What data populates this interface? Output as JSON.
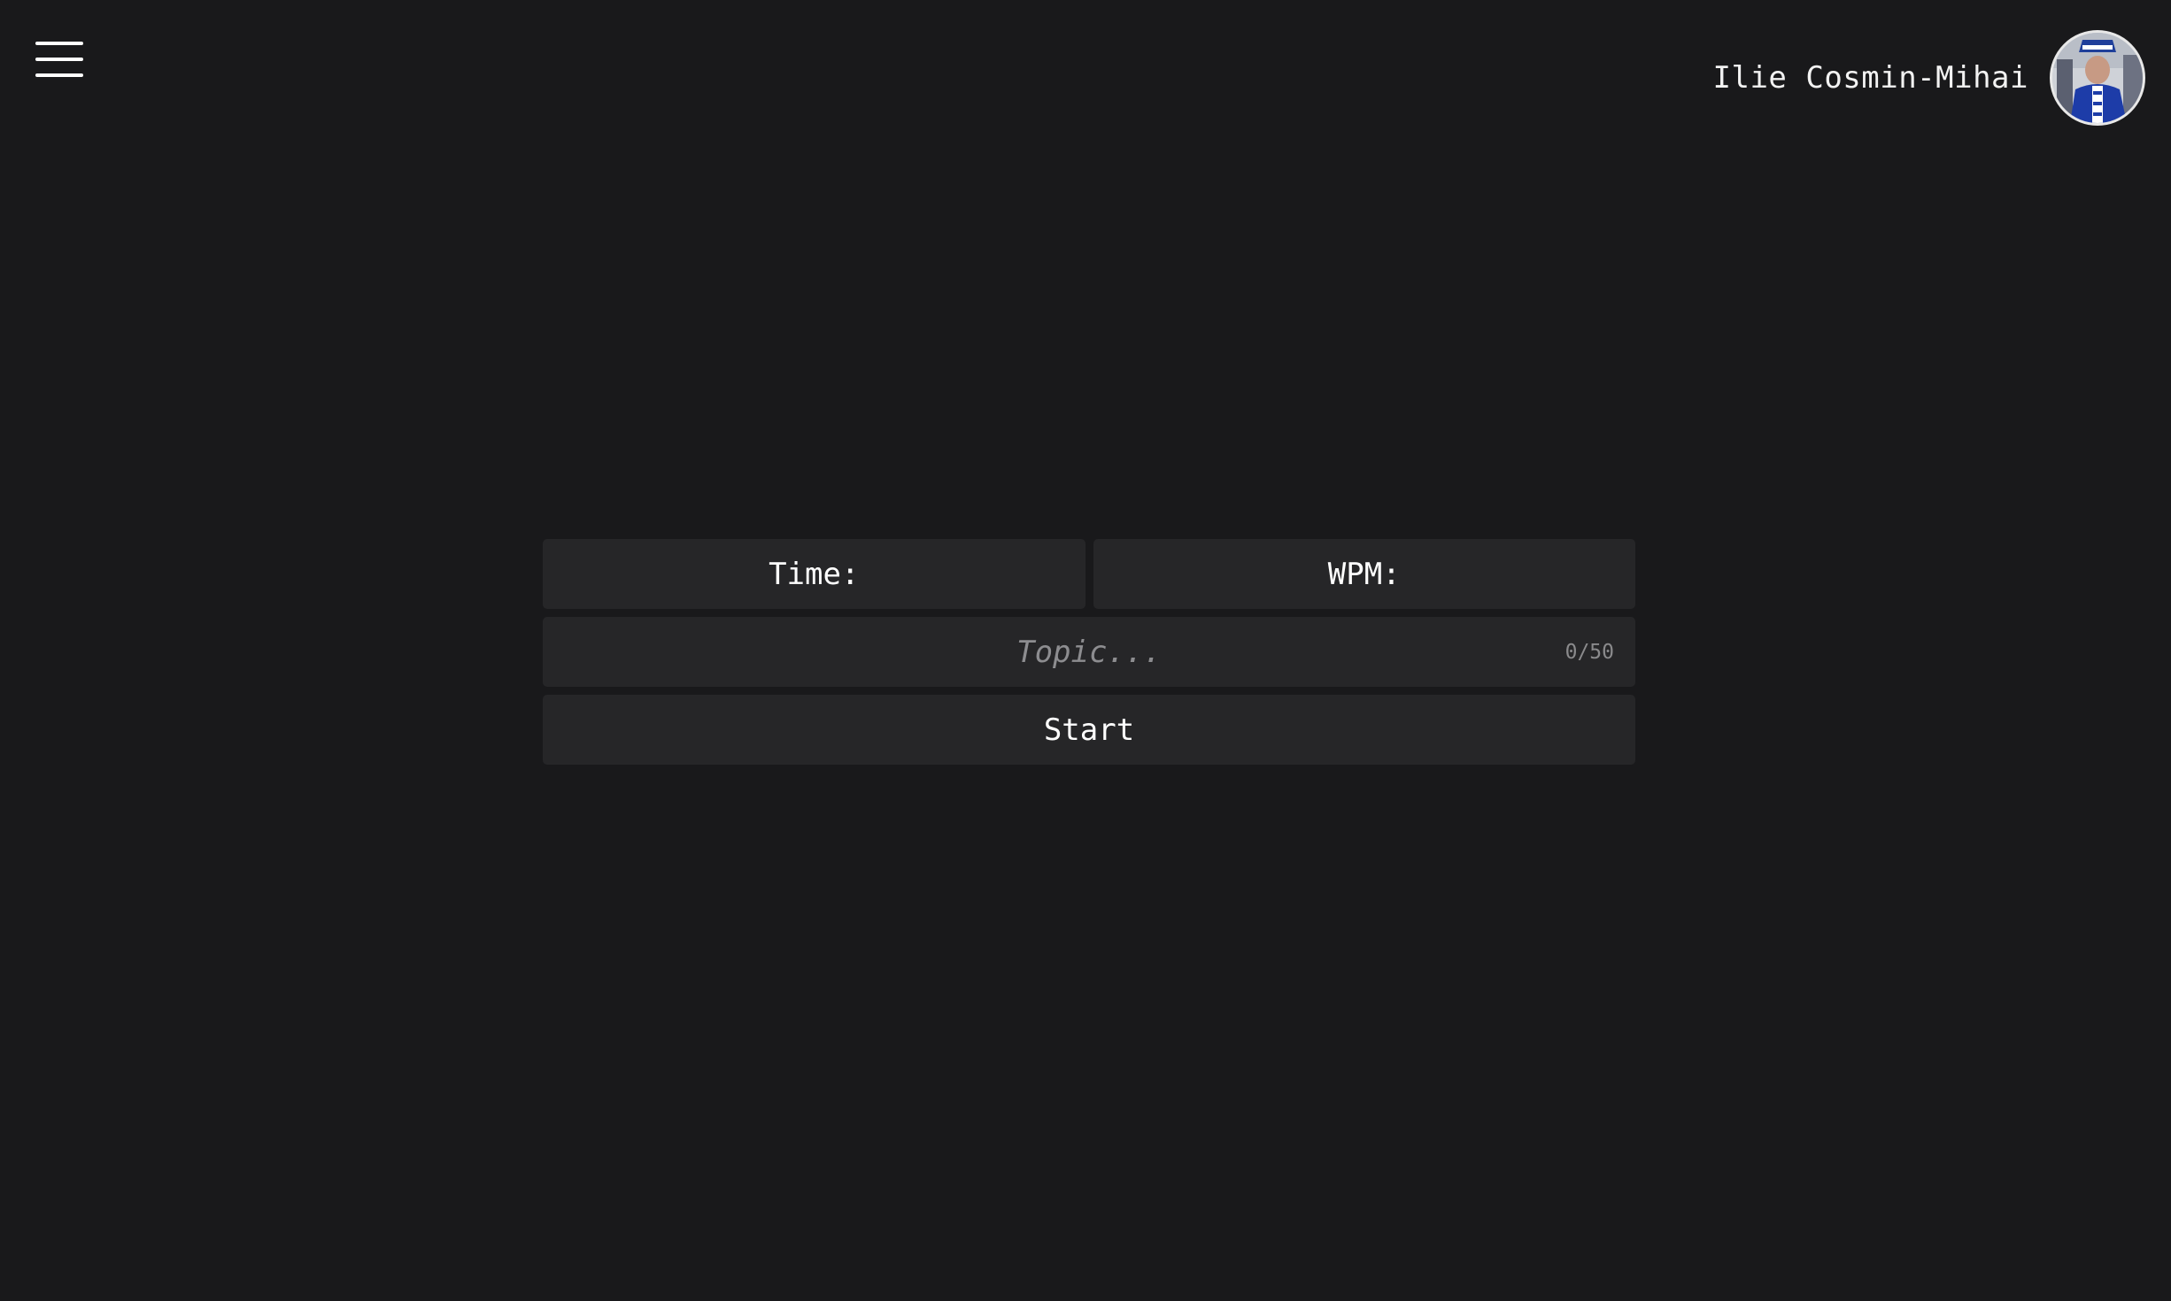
{
  "header": {
    "menu_icon": "hamburger-menu-icon",
    "user_name": "Ilie Cosmin-Mihai",
    "avatar_description": "profile photo"
  },
  "stats": {
    "time_label": "Time:",
    "wpm_label": "WPM:"
  },
  "topic": {
    "value": "",
    "placeholder": "Topic...",
    "counter": "0/50"
  },
  "actions": {
    "start_label": "Start"
  },
  "colors": {
    "background": "#19191b",
    "panel": "#262628",
    "text": "#ffffff",
    "placeholder": "#8d8d90"
  }
}
